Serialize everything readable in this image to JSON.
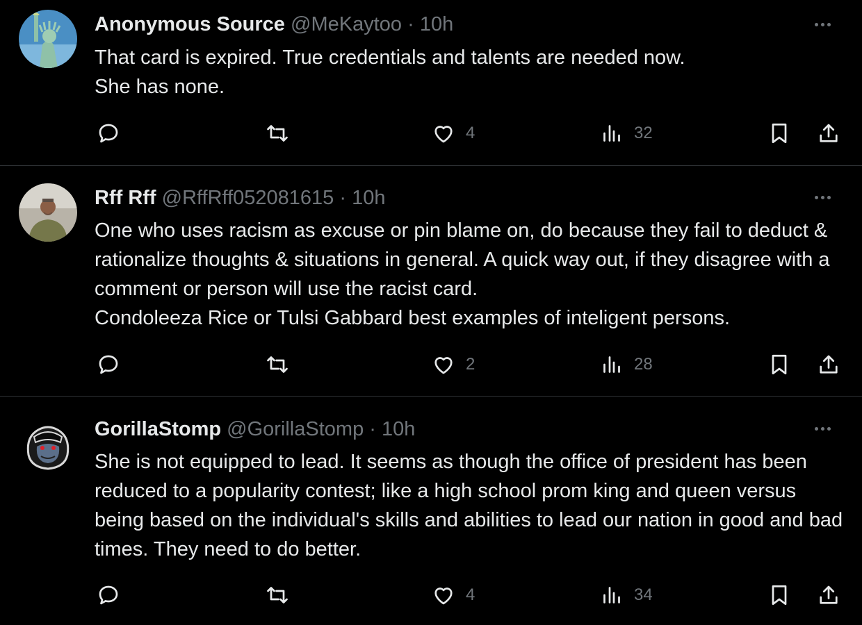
{
  "colors": {
    "background": "#000000",
    "text_primary": "#e7e9ea",
    "text_secondary": "#71767b",
    "divider": "#2f3336"
  },
  "tweets": [
    {
      "display_name": "Anonymous Source",
      "handle": "@MeKaytoo",
      "separator": "·",
      "time": "10h",
      "avatar_icon": "statue-of-liberty-avatar",
      "text": "That card is expired.  True credentials and talents are needed now.\nShe has none.",
      "likes": "4",
      "views": "32"
    },
    {
      "display_name": "Rff Rff",
      "handle": "@RffRff052081615",
      "separator": "·",
      "time": "10h",
      "avatar_icon": "person-photo-avatar",
      "text": "One who uses racism as excuse or pin blame on, do because they fail to deduct & rationalize thoughts & situations in general. A quick way out, if they disagree with a comment or person will use the racist card.\nCondoleeza Rice or Tulsi Gabbard best examples of inteligent persons.",
      "likes": "2",
      "views": "28"
    },
    {
      "display_name": "GorillaStomp",
      "handle": "@GorillaStomp",
      "separator": "·",
      "time": "10h",
      "avatar_icon": "gorilla-cartoon-avatar",
      "text": "She is not equipped to lead.  It seems as though the office of president has been reduced to a popularity contest; like a high school prom king and queen versus being based on the individual's skills and abilities to lead our nation in good and bad times.  They need to do better.",
      "likes": "4",
      "views": "34"
    }
  ],
  "icons": {
    "reply": "reply-icon",
    "retweet": "retweet-icon",
    "like": "heart-icon",
    "views": "views-chart-icon",
    "bookmark": "bookmark-icon",
    "share": "share-icon",
    "more": "more-options-icon"
  }
}
